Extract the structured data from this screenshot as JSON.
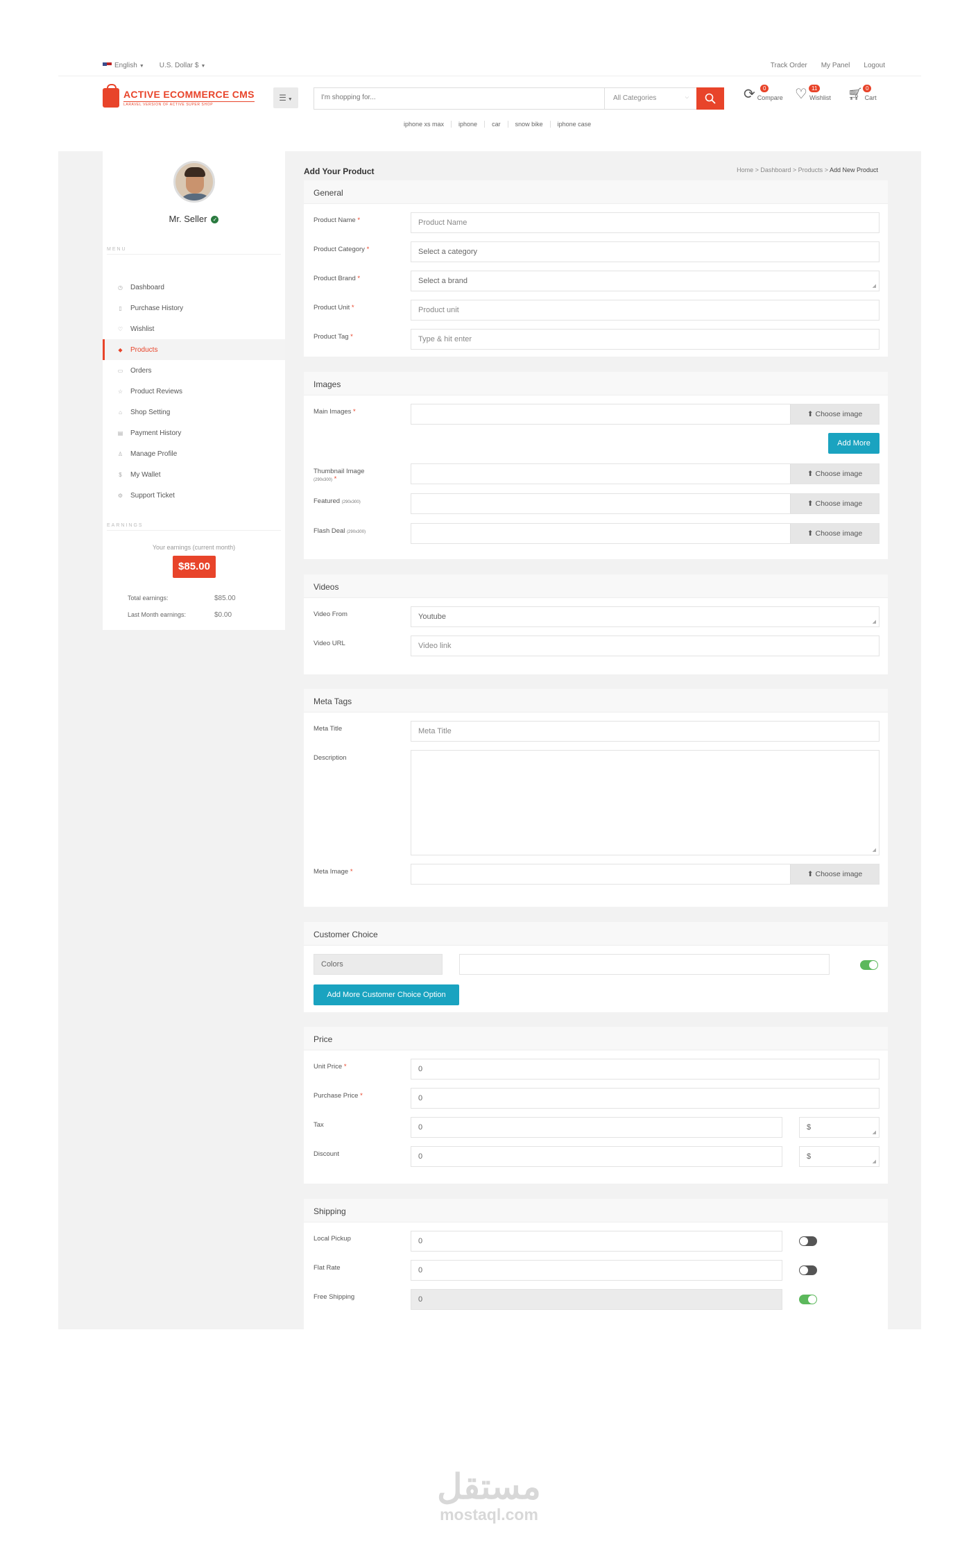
{
  "topbar": {
    "language": "English",
    "currency": "U.S. Dollar $",
    "links": [
      "Track Order",
      "My Panel",
      "Logout"
    ]
  },
  "header": {
    "logo_title": "ACTIVE ECOMMERCE CMS",
    "logo_subtitle": "LARAVEL VERSION OF ACTIVE SUPER SHOP",
    "search_placeholder": "I'm shopping for...",
    "category_select": "All Categories",
    "compare": {
      "label": "Compare",
      "count": "0"
    },
    "wishlist": {
      "label": "Wishlist",
      "count": "11"
    },
    "cart": {
      "label": "Cart",
      "count": "0"
    },
    "popular_tags": [
      "iphone xs max",
      "iphone",
      "car",
      "snow bike",
      "iphone case"
    ]
  },
  "sidebar": {
    "seller_name": "Mr. Seller",
    "menu_heading": "MENU",
    "menu": [
      {
        "label": "Dashboard",
        "icon": "dashboard-icon",
        "glyph": "◷"
      },
      {
        "label": "Purchase History",
        "icon": "file-icon",
        "glyph": "▯"
      },
      {
        "label": "Wishlist",
        "icon": "heart-icon",
        "glyph": "♡"
      },
      {
        "label": "Products",
        "icon": "diamond-icon",
        "glyph": "◆",
        "active": true
      },
      {
        "label": "Orders",
        "icon": "orders-icon",
        "glyph": "▭"
      },
      {
        "label": "Product Reviews",
        "icon": "star-icon",
        "glyph": "☆"
      },
      {
        "label": "Shop Setting",
        "icon": "shop-icon",
        "glyph": "⌂"
      },
      {
        "label": "Payment History",
        "icon": "card-icon",
        "glyph": "▤"
      },
      {
        "label": "Manage Profile",
        "icon": "user-icon",
        "glyph": "♙"
      },
      {
        "label": "My Wallet",
        "icon": "dollar-icon",
        "glyph": "$"
      },
      {
        "label": "Support Ticket",
        "icon": "support-icon",
        "glyph": "⚙"
      }
    ],
    "earnings_heading": "EARNINGS",
    "earnings_current_label": "Your earnings (current month)",
    "earnings_current_value": "$85.00",
    "total_label": "Total earnings:",
    "total_value": "$85.00",
    "last_month_label": "Last Month earnings:",
    "last_month_value": "$0.00"
  },
  "page": {
    "title": "Add Your Product",
    "breadcrumb": [
      "Home",
      "Dashboard",
      "Products",
      "Add New Product"
    ]
  },
  "general": {
    "heading": "General",
    "name_label": "Product Name",
    "name_placeholder": "Product Name",
    "category_label": "Product Category",
    "category_value": "Select a category",
    "brand_label": "Product Brand",
    "brand_value": "Select a brand",
    "unit_label": "Product Unit",
    "unit_placeholder": "Product unit",
    "tag_label": "Product Tag",
    "tag_placeholder": "Type & hit enter"
  },
  "images": {
    "heading": "Images",
    "main_label": "Main Images",
    "choose_label": "Choose image",
    "add_more": "Add More",
    "thumb_label": "Thumbnail Image",
    "thumb_size": "(290x300)",
    "featured_label": "Featured",
    "featured_size": "(290x300)",
    "flash_label": "Flash Deal",
    "flash_size": "(290x300)"
  },
  "videos": {
    "heading": "Videos",
    "from_label": "Video From",
    "from_value": "Youtube",
    "url_label": "Video URL",
    "url_placeholder": "Video link"
  },
  "meta": {
    "heading": "Meta Tags",
    "title_label": "Meta Title",
    "title_placeholder": "Meta Title",
    "desc_label": "Description",
    "image_label": "Meta Image"
  },
  "choice": {
    "heading": "Customer Choice",
    "colors_label": "Colors",
    "colors_enabled": true,
    "add_option": "Add More Customer Choice Option"
  },
  "price": {
    "heading": "Price",
    "unit_label": "Unit Price",
    "unit_value": "0",
    "purchase_label": "Purchase Price",
    "purchase_value": "0",
    "tax_label": "Tax",
    "tax_value": "0",
    "tax_type": "$",
    "discount_label": "Discount",
    "discount_value": "0",
    "discount_type": "$"
  },
  "shipping": {
    "heading": "Shipping",
    "local_label": "Local Pickup",
    "local_value": "0",
    "local_enabled": false,
    "flat_label": "Flat Rate",
    "flat_value": "0",
    "flat_enabled": false,
    "free_label": "Free Shipping",
    "free_value": "0",
    "free_enabled": true
  },
  "watermark": {
    "arabic": "مستقل",
    "latin": "mostaql.com"
  },
  "colors": {
    "accent": "#e8442a",
    "teal": "#1aa3c0",
    "toggle_on": "#5cb85c"
  }
}
